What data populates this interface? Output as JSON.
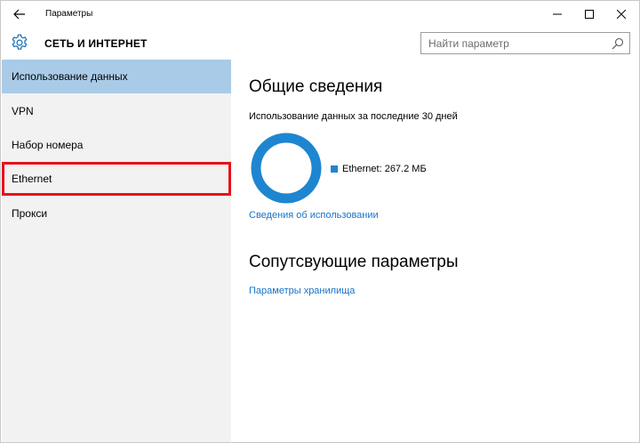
{
  "window": {
    "title": "Параметры",
    "icons": {
      "back": "back-arrow-icon",
      "minimize": "minimize-icon",
      "maximize": "maximize-icon",
      "close": "close-icon"
    }
  },
  "header": {
    "title": "СЕТЬ И ИНТЕРНЕТ",
    "icon": "gear-icon",
    "search_placeholder": "Найти параметр",
    "search_icon": "search-icon"
  },
  "sidebar": {
    "items": [
      {
        "label": "Использование данных",
        "active": true
      },
      {
        "label": "VPN"
      },
      {
        "label": "Набор номера"
      },
      {
        "label": "Ethernet",
        "highlighted": true
      },
      {
        "label": "Прокси"
      }
    ]
  },
  "main": {
    "overview_heading": "Общие сведения",
    "usage_caption": "Использование данных за последние 30 дней",
    "usage_details_link": "Сведения об использовании",
    "related_heading": "Сопутсвующие параметры",
    "storage_link": "Параметры хранилища"
  },
  "chart_data": {
    "type": "pie",
    "title": "",
    "categories": [
      "Ethernet: 267.2 МБ"
    ],
    "values": [
      267.2
    ],
    "legend_placement": "right"
  },
  "colors": {
    "accent": "#1e86d0",
    "link": "#1873c9",
    "active_item": "#a9cbe8",
    "highlight_border": "#e8131c",
    "sidebar_bg": "#f2f2f2"
  }
}
